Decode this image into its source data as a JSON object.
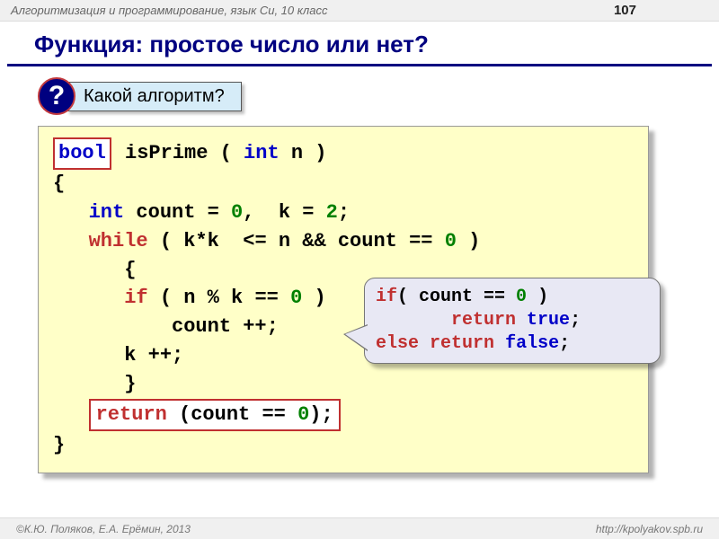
{
  "header": {
    "title": "Алгоритмизация и программирование, язык Си, 10 класс",
    "page": "107"
  },
  "title": "Функция: простое число или нет?",
  "question": {
    "badge": "?",
    "label": "Какой алгоритм?"
  },
  "code": {
    "bool_kw": "bool",
    "sig_before_int": " isPrime ( ",
    "int_kw": "int",
    "sig_after_int": " n )",
    "brace_open": "{",
    "decl_indent": "   ",
    "decl_after_int": " count = ",
    "zero": "0",
    "decl_k": ",  k = ",
    "two": "2",
    "semi": ";",
    "while_indent": "   ",
    "while_kw": "while",
    "while_cond": " ( k*k  <= n && count == ",
    "while_close": " )",
    "inner_open": "      {",
    "if_indent": "      ",
    "if_kw": "if",
    "if_cond": " ( n % k == ",
    "if_close": " ) ",
    "count_line": "          count ++;",
    "k_line": "      k ++;",
    "inner_close": "      }",
    "ret_indent": "   ",
    "return_kw": "return",
    "ret_expr": " (count == ",
    "ret_close": ");",
    "brace_close": "}"
  },
  "callout": {
    "if_kw": "if",
    "if_text": "( count == ",
    "zero": "0",
    "if_close": " )",
    "ret_kw": "return",
    "true_kw": "true",
    "else_kw": "else",
    "false_kw": "false",
    "semi": ";"
  },
  "footer": {
    "left": "К.Ю. Поляков, Е.А. Ерёмин, 2013",
    "right": "http://kpolyakov.spb.ru"
  }
}
